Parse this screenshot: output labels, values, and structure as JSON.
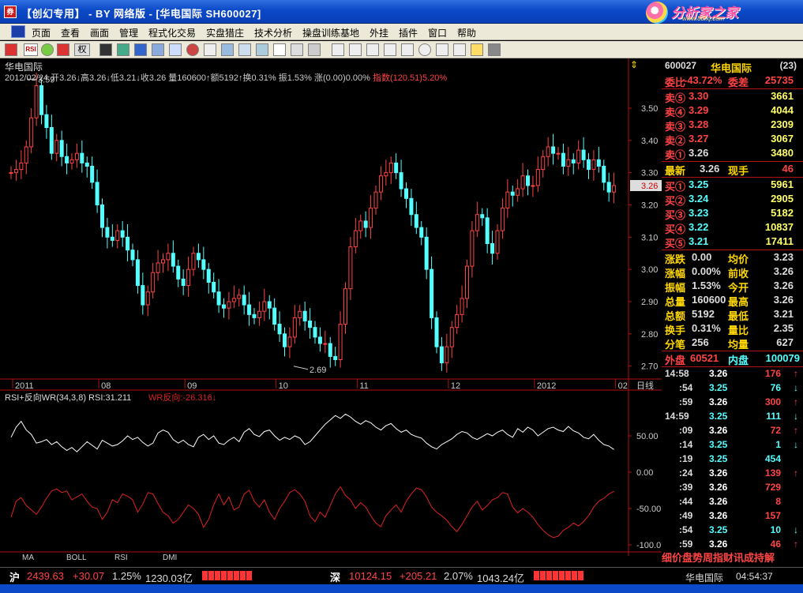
{
  "window": {
    "title": "【创幻专用】 - BY 网络版 - [华电国际 SH600027]",
    "brand_text": "分析家之家",
    "brand_sub": "www.88fxj.com",
    "app_icon_label": "券"
  },
  "menu": [
    "页面",
    "查看",
    "画面",
    "管理",
    "程式化交易",
    "实盘猎庄",
    "技术分析",
    "操盘训练基地",
    "外挂",
    "插件",
    "窗口",
    "帮助"
  ],
  "toolbar": {
    "quan_label": "权",
    "rsi_label": "RSI"
  },
  "chart": {
    "name": "华电国际",
    "quote_main": "2012/02/24 开3.26↓高3.26↓低3.21↓收3.26 量160600↑额5192↑换0.31% 振1.53% 涨(0.00)0.00%",
    "quote_index": "指数(120.51)5.20%",
    "high_marker": "3.59",
    "low_marker": "2.69",
    "last_price_tag": "3.26",
    "price_ticks": [
      "3.50",
      "3.40",
      "3.30",
      "3.20",
      "3.10",
      "3.00",
      "2.90",
      "2.80",
      "2.70"
    ],
    "date_ticks": [
      "2011",
      "08",
      "09",
      "10",
      "11",
      "12",
      "2012",
      "02"
    ],
    "period_label": "日线",
    "indicator_header": "RSI+反向WR(34,3,8) RSI:31.211",
    "indicator_wr": "WR反向:-26.316↓",
    "indicator_ticks": [
      "50.00",
      "0.00",
      "-50.00",
      "-100.0"
    ],
    "colors": {
      "up": "#ff4444",
      "down": "#54ffff",
      "rsi": "#ffffff",
      "wr": "#dd2222",
      "axis": "#b01010"
    }
  },
  "chart_data": [
    {
      "type": "candlestick",
      "title": "华电国际",
      "ylim": [
        2.66,
        3.62
      ],
      "x_ticks": [
        "2011",
        "08",
        "09",
        "10",
        "11",
        "12",
        "2012",
        "02"
      ],
      "series": [
        {
          "name": "华电国际",
          "values": [
            3.3,
            3.31,
            3.33,
            3.38,
            3.47,
            3.57,
            3.48,
            3.44,
            3.36,
            3.4,
            3.35,
            3.33,
            3.34,
            3.36,
            3.33,
            3.32,
            3.27,
            3.2,
            3.13,
            3.1,
            3.09,
            3.12,
            3.1,
            3.06,
            3.03,
            2.95,
            2.89,
            2.93,
            2.99,
            3.02,
            3.03,
            3.05,
            3.01,
            2.97,
            2.95,
            3.0,
            3.05,
            3.03,
            3.0,
            2.96,
            2.93,
            2.89,
            2.88,
            2.9,
            2.91,
            2.92,
            2.89,
            2.86,
            2.85,
            2.87,
            2.9,
            2.88,
            2.83,
            2.8,
            2.76,
            2.79,
            2.85,
            2.87,
            2.84,
            2.82,
            2.79,
            2.77,
            2.77,
            2.73,
            2.72,
            2.83,
            2.94,
            3.07,
            3.12,
            3.15,
            3.13,
            3.19,
            3.24,
            3.29,
            3.3,
            3.33,
            3.3,
            3.25,
            3.22,
            3.17,
            3.13,
            3.1,
            3.0,
            2.85,
            2.76,
            2.71,
            2.76,
            2.82,
            2.86,
            2.91,
            3.01,
            3.12,
            3.17,
            3.16,
            3.08,
            3.05,
            3.12,
            3.19,
            3.24,
            3.23,
            3.25,
            3.29,
            3.26,
            3.26,
            3.31,
            3.35,
            3.38,
            3.36,
            3.36,
            3.32,
            3.34,
            3.33,
            3.37,
            3.34,
            3.31,
            3.34,
            3.32,
            3.27,
            3.24,
            3.26
          ]
        }
      ]
    },
    {
      "type": "line",
      "title": "RSI+反向WR(34,3,8)",
      "ylim": [
        -100,
        100
      ],
      "series": [
        {
          "name": "RSI",
          "values": [
            48,
            62,
            70,
            58,
            52,
            40,
            42,
            45,
            38,
            42,
            35,
            30,
            34,
            28,
            35,
            42,
            37,
            32,
            44,
            40,
            36,
            38,
            43,
            50,
            45,
            48,
            41,
            36,
            40,
            54,
            58,
            55,
            45,
            40,
            44,
            38,
            35,
            48,
            52,
            45,
            50,
            40,
            38,
            44,
            48,
            42,
            55,
            60,
            52,
            49,
            56,
            58,
            50,
            44,
            48,
            45,
            50,
            47,
            38,
            42,
            50,
            58,
            66,
            72,
            78,
            74,
            80,
            76,
            70,
            66,
            71,
            68,
            62,
            58,
            64,
            67,
            60,
            55,
            58,
            52,
            49,
            47,
            40,
            35,
            32,
            38,
            42,
            46,
            52,
            56,
            54,
            48,
            45,
            49,
            53,
            50,
            55,
            58,
            52,
            48,
            60,
            55,
            62,
            58,
            50,
            55,
            60,
            62,
            58,
            56,
            63,
            57,
            54,
            48,
            46,
            52,
            44,
            38,
            36,
            31.211
          ]
        },
        {
          "name": "WR反向",
          "values": [
            -62,
            -40,
            -35,
            -46,
            -52,
            -58,
            -48,
            -36,
            -26,
            -23,
            -28,
            -26,
            -38,
            -34,
            -30,
            -40,
            -48,
            -50,
            -65,
            -55,
            -38,
            -42,
            -30,
            -33,
            -38,
            -55,
            -44,
            -28,
            -30,
            -43,
            -55,
            -60,
            -70,
            -65,
            -55,
            -45,
            -50,
            -58,
            -76,
            -65,
            -45,
            -30,
            -45,
            -34,
            -52,
            -48,
            -30,
            -25,
            -40,
            -48,
            -38,
            -55,
            -65,
            -50,
            -40,
            -28,
            -24,
            -30,
            -40,
            -60,
            -68,
            -55,
            -62,
            -46,
            -30,
            -20,
            -32,
            -38,
            -50,
            -42,
            -48,
            -60,
            -70,
            -75,
            -60,
            -52,
            -45,
            -55,
            -40,
            -30,
            -22,
            -24,
            -34,
            -48,
            -55,
            -60,
            -66,
            -75,
            -82,
            -72,
            -60,
            -48,
            -40,
            -52,
            -46,
            -38,
            -35,
            -28,
            -30,
            -48,
            -56,
            -50,
            -55,
            -62,
            -72,
            -80,
            -86,
            -90,
            -88,
            -80,
            -76,
            -70,
            -74,
            -68,
            -60,
            -48,
            -40,
            -36,
            -30,
            -26.316
          ]
        }
      ]
    }
  ],
  "quote_panel": {
    "code": "600027",
    "name": "华电国际",
    "count": "(23)",
    "weibi_label": "委比",
    "weibi_value": "-43.72%",
    "weicha_label": "委差",
    "weicha_value": "25735",
    "sell": [
      {
        "label": "卖⑤",
        "price": "3.30",
        "vol": "3661"
      },
      {
        "label": "卖④",
        "price": "3.29",
        "vol": "4044"
      },
      {
        "label": "卖③",
        "price": "3.28",
        "vol": "2309"
      },
      {
        "label": "卖②",
        "price": "3.27",
        "vol": "3067"
      },
      {
        "label": "卖①",
        "price": "3.26",
        "vol": "3480"
      }
    ],
    "last_label": "最新",
    "last_price": "3.26",
    "now_hand_label": "现手",
    "now_hand": "46",
    "buy": [
      {
        "label": "买①",
        "price": "3.25",
        "vol": "5961"
      },
      {
        "label": "买②",
        "price": "3.24",
        "vol": "2905"
      },
      {
        "label": "买③",
        "price": "3.23",
        "vol": "5182"
      },
      {
        "label": "买④",
        "price": "3.22",
        "vol": "10837"
      },
      {
        "label": "买⑤",
        "price": "3.21",
        "vol": "17411"
      }
    ],
    "stats": [
      {
        "l1": "涨跌",
        "v1": "0.00",
        "l2": "均价",
        "v2": "3.23"
      },
      {
        "l1": "涨幅",
        "v1": "0.00%",
        "l2": "前收",
        "v2": "3.26"
      },
      {
        "l1": "振幅",
        "v1": "1.53%",
        "l2": "今开",
        "v2": "3.26"
      },
      {
        "l1": "总量",
        "v1": "160600",
        "l2": "最高",
        "v2": "3.26"
      },
      {
        "l1": "总额",
        "v1": "5192",
        "l2": "最低",
        "v2": "3.21"
      },
      {
        "l1": "换手",
        "v1": "0.31%",
        "l2": "量比",
        "v2": "2.35"
      },
      {
        "l1": "分笔",
        "v1": "256",
        "l2": "均量",
        "v2": "627"
      }
    ],
    "outer_label": "外盘",
    "outer_value": "60521",
    "inner_label": "内盘",
    "inner_value": "100079",
    "ticks": [
      {
        "time": "14:58",
        "price": "3.26",
        "vol": "176",
        "dir": "↑",
        "pc": "#fff",
        "vc": "#ff4444"
      },
      {
        "time": ":54",
        "price": "3.25",
        "vol": "76",
        "dir": "↓",
        "pc": "#54ffff",
        "vc": "#54ffff"
      },
      {
        "time": ":59",
        "price": "3.26",
        "vol": "300",
        "dir": "↑",
        "pc": "#fff",
        "vc": "#ff4444"
      },
      {
        "time": "14:59",
        "price": "3.25",
        "vol": "111",
        "dir": "↓",
        "pc": "#54ffff",
        "vc": "#54ffff"
      },
      {
        "time": ":09",
        "price": "3.26",
        "vol": "72",
        "dir": "↑",
        "pc": "#fff",
        "vc": "#ff4444"
      },
      {
        "time": ":14",
        "price": "3.25",
        "vol": "1",
        "dir": "↓",
        "pc": "#54ffff",
        "vc": "#54ffff"
      },
      {
        "time": ":19",
        "price": "3.25",
        "vol": "454",
        "dir": "",
        "pc": "#54ffff",
        "vc": "#54ffff"
      },
      {
        "time": ":24",
        "price": "3.26",
        "vol": "139",
        "dir": "↑",
        "pc": "#fff",
        "vc": "#ff4444"
      },
      {
        "time": ":39",
        "price": "3.26",
        "vol": "729",
        "dir": "",
        "pc": "#fff",
        "vc": "#ff4444"
      },
      {
        "time": ":44",
        "price": "3.26",
        "vol": "8",
        "dir": "",
        "pc": "#fff",
        "vc": "#ff4444"
      },
      {
        "time": ":49",
        "price": "3.26",
        "vol": "157",
        "dir": "",
        "pc": "#fff",
        "vc": "#ff4444"
      },
      {
        "time": ":54",
        "price": "3.25",
        "vol": "10",
        "dir": "↓",
        "pc": "#54ffff",
        "vc": "#54ffff"
      },
      {
        "time": ":59",
        "price": "3.26",
        "vol": "46",
        "dir": "↑",
        "pc": "#fff",
        "vc": "#ff4444"
      }
    ],
    "bottom_tabs": "细价盘势周指财讯成持解"
  },
  "indicator_tabs": [
    "MA",
    "BOLL",
    "RSI",
    "DMI"
  ],
  "status": {
    "sh_label": "沪",
    "sh_index": "2439.63",
    "sh_change": "+30.07",
    "sh_pct": "1.25%",
    "sh_amount": "1230.03亿",
    "sz_label": "深",
    "sz_index": "10124.15",
    "sz_change": "+205.21",
    "sz_pct": "2.07%",
    "sz_amount": "1043.24亿",
    "stock": "华电国际",
    "time": "04:54:37"
  }
}
